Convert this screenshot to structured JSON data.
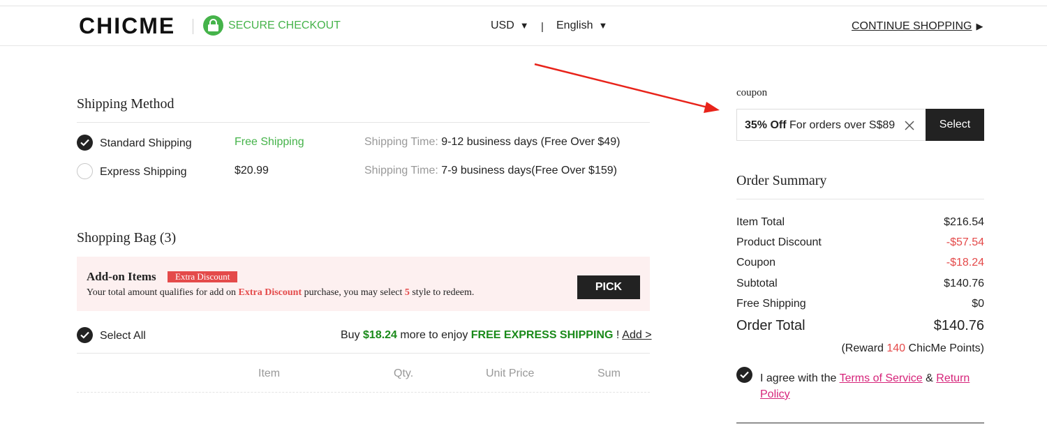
{
  "header": {
    "logo": "CHICME",
    "secure_label": "SECURE CHECKOUT",
    "currency": "USD",
    "separator": "|",
    "language": "English",
    "continue_label": "CONTINUE SHOPPING",
    "colors": {
      "secure_green": "#45b34a"
    }
  },
  "shipping": {
    "title": "Shipping Method",
    "options": [
      {
        "name": "Standard Shipping",
        "price": "Free Shipping",
        "time_label": "Shipping Time:",
        "time_value": "9-12 business days (Free Over $49)",
        "selected": true
      },
      {
        "name": "Express Shipping",
        "price": "$20.99",
        "time_label": "Shipping Time:",
        "time_value": "7-9 business days(Free Over $159)",
        "selected": false
      }
    ]
  },
  "bag": {
    "title": "Shopping Bag (3)",
    "addon": {
      "title": "Add-on Items",
      "badge": "Extra Discount",
      "text_before": "Your total amount qualifies for add on ",
      "text_highlight": "Extra Discount",
      "text_middle": " purchase, you may select ",
      "count": "5",
      "text_after": " style to redeem.",
      "pick_label": "PICK"
    },
    "select_all": "Select All",
    "promo": {
      "prefix": "Buy ",
      "amount": "$18.24",
      "middle": " more to enjoy ",
      "highlight": "FREE EXPRESS SHIPPING",
      "bang": " !",
      "link": "Add >"
    },
    "columns": [
      "Item",
      "Qty.",
      "Unit Price",
      "Sum"
    ]
  },
  "coupon": {
    "label": "coupon",
    "bold": "35% Off",
    "text": " For orders over S$89",
    "select_label": "Select"
  },
  "summary": {
    "title": "Order Summary",
    "rows": [
      {
        "label": "Item Total",
        "value": "$216.54"
      },
      {
        "label": "Product Discount",
        "value": "-$57.54"
      },
      {
        "label": "Coupon",
        "value": "-$18.24"
      },
      {
        "label": "Subtotal",
        "value": "$140.76"
      },
      {
        "label": "Free Shipping",
        "value": "$0"
      }
    ],
    "total_label": "Order Total",
    "total_value": "$140.76",
    "reward_prefix": "(Reward ",
    "reward_points": "140",
    "reward_suffix": " ChicMe Points)",
    "agree_text": "I agree with the ",
    "terms_link": "Terms of Service",
    "amp": " & ",
    "return_link": "Return Policy",
    "colors": {
      "negative": "#e44a4a",
      "link": "#d6247a"
    }
  },
  "annotation": {
    "arrow_color": "#e8231a"
  }
}
